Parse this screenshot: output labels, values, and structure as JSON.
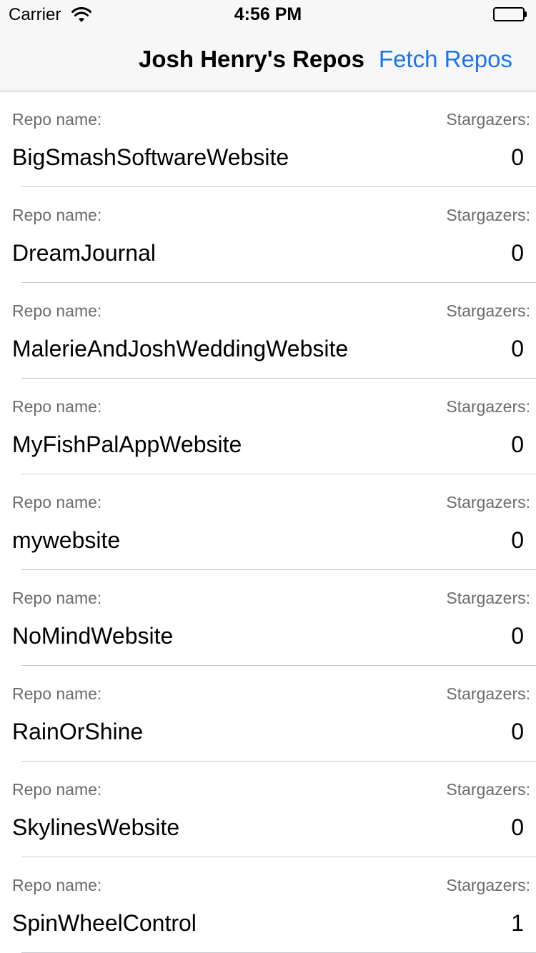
{
  "status_bar": {
    "carrier": "Carrier",
    "time": "4:56 PM",
    "icons": [
      "wifi-icon",
      "battery-icon"
    ]
  },
  "nav_bar": {
    "title": "Josh Henry's Repos",
    "action_label": "Fetch Repos",
    "accent_color": "#1b73f5"
  },
  "repos": [
    {
      "name_label": "Repo name:",
      "name": "BigSmashSoftwareWebsite",
      "stars_label": "Stargazers:",
      "stars": "0"
    },
    {
      "name_label": "Repo name:",
      "name": "DreamJournal",
      "stars_label": "Stargazers:",
      "stars": "0"
    },
    {
      "name_label": "Repo name:",
      "name": "MalerieAndJoshWeddingWebsite",
      "stars_label": "Stargazers:",
      "stars": "0"
    },
    {
      "name_label": "Repo name:",
      "name": "MyFishPalAppWebsite",
      "stars_label": "Stargazers:",
      "stars": "0"
    },
    {
      "name_label": "Repo name:",
      "name": "mywebsite",
      "stars_label": "Stargazers:",
      "stars": "0"
    },
    {
      "name_label": "Repo name:",
      "name": "NoMindWebsite",
      "stars_label": "Stargazers:",
      "stars": "0"
    },
    {
      "name_label": "Repo name:",
      "name": "RainOrShine",
      "stars_label": "Stargazers:",
      "stars": "0"
    },
    {
      "name_label": "Repo name:",
      "name": "SkylinesWebsite",
      "stars_label": "Stargazers:",
      "stars": "0"
    },
    {
      "name_label": "Repo name:",
      "name": "SpinWheelControl",
      "stars_label": "Stargazers:",
      "stars": "1"
    }
  ]
}
